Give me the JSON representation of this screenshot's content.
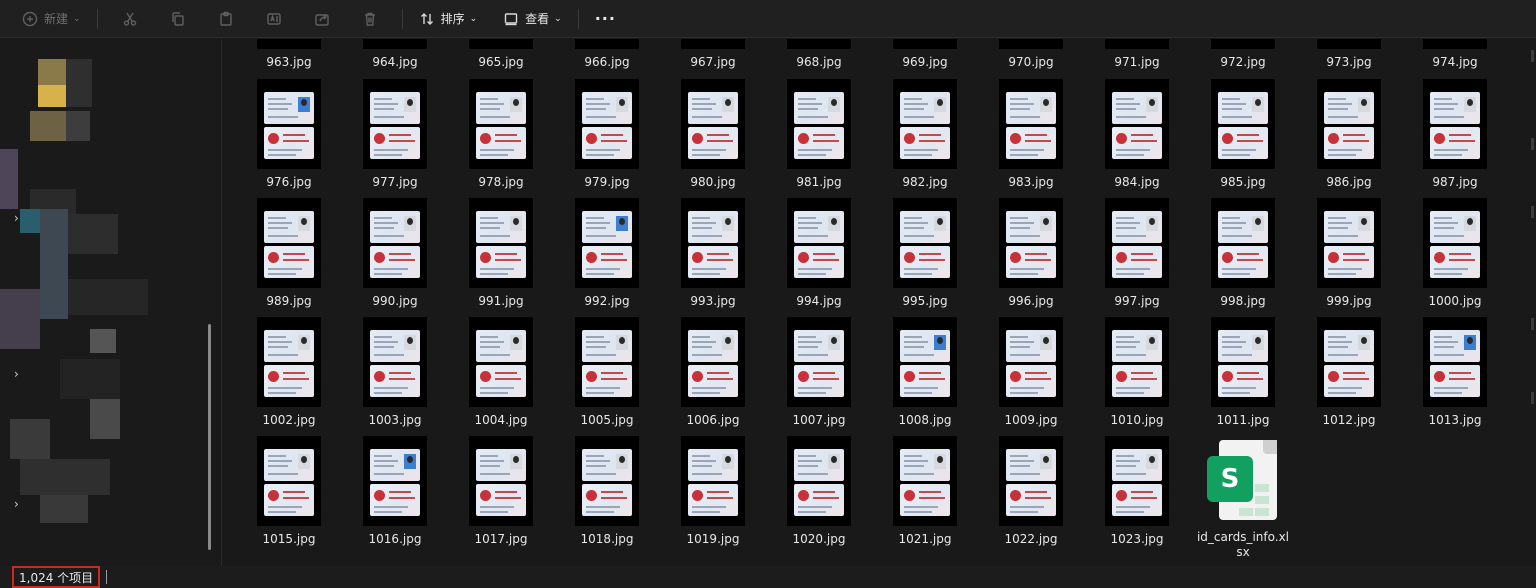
{
  "toolbar": {
    "new_label": "新建",
    "sort_label": "排序",
    "view_label": "查看",
    "more_label": "···"
  },
  "files": {
    "row0": [
      "963.jpg",
      "964.jpg",
      "965.jpg",
      "966.jpg",
      "967.jpg",
      "968.jpg",
      "969.jpg",
      "970.jpg",
      "971.jpg",
      "972.jpg",
      "973.jpg",
      "974.jpg"
    ],
    "row1": [
      "976.jpg",
      "977.jpg",
      "978.jpg",
      "979.jpg",
      "980.jpg",
      "981.jpg",
      "982.jpg",
      "983.jpg",
      "984.jpg",
      "985.jpg",
      "986.jpg",
      "987.jpg"
    ],
    "row2": [
      "989.jpg",
      "990.jpg",
      "991.jpg",
      "992.jpg",
      "993.jpg",
      "994.jpg",
      "995.jpg",
      "996.jpg",
      "997.jpg",
      "998.jpg",
      "999.jpg",
      "1000.jpg"
    ],
    "row3": [
      "1002.jpg",
      "1003.jpg",
      "1004.jpg",
      "1005.jpg",
      "1006.jpg",
      "1007.jpg",
      "1008.jpg",
      "1009.jpg",
      "1010.jpg",
      "1011.jpg",
      "1012.jpg",
      "1013.jpg"
    ],
    "row4": [
      "1015.jpg",
      "1016.jpg",
      "1017.jpg",
      "1018.jpg",
      "1019.jpg",
      "1020.jpg",
      "1021.jpg",
      "1022.jpg",
      "1023.jpg"
    ],
    "spreadsheet": "id_cards_info.xlsx",
    "spreadsheet_badge": "S"
  },
  "status": {
    "item_count": "1,024 个项目"
  },
  "colors": {
    "accent_excel": "#12a061",
    "highlight_box": "#d0281f",
    "background": "#191919"
  }
}
